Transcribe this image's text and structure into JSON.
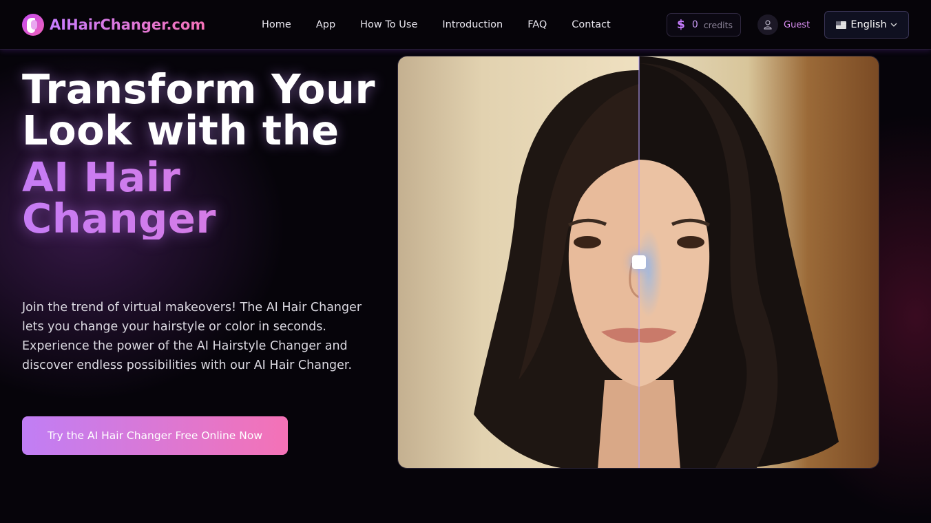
{
  "brand": {
    "name": "AIHairChanger.com"
  },
  "nav": {
    "items": [
      {
        "label": "Home"
      },
      {
        "label": "App"
      },
      {
        "label": "How To Use"
      },
      {
        "label": "Introduction"
      },
      {
        "label": "FAQ"
      },
      {
        "label": "Contact"
      }
    ]
  },
  "credits": {
    "symbol": "$",
    "count": "0",
    "label": "credits"
  },
  "user": {
    "name": "Guest",
    "icon": "user-icon"
  },
  "language": {
    "selected": "English",
    "icon": "flag-icon"
  },
  "hero": {
    "title_line1": "Transform Your Look with the",
    "title_highlight": "AI Hair Changer",
    "description": "Join the trend of virtual makeovers! The AI Hair Changer lets you change your hairstyle or color in seconds. Experience the power of the AI Hairstyle Changer and discover endless possibilities with our AI Hair Changer.",
    "cta_label": "Try the AI Hair Changer Free Online Now"
  },
  "compare": {
    "slider_percent": 50
  },
  "colors": {
    "accent_purple": "#c77dff",
    "accent_pink": "#f472b6",
    "background": "#06040a"
  }
}
